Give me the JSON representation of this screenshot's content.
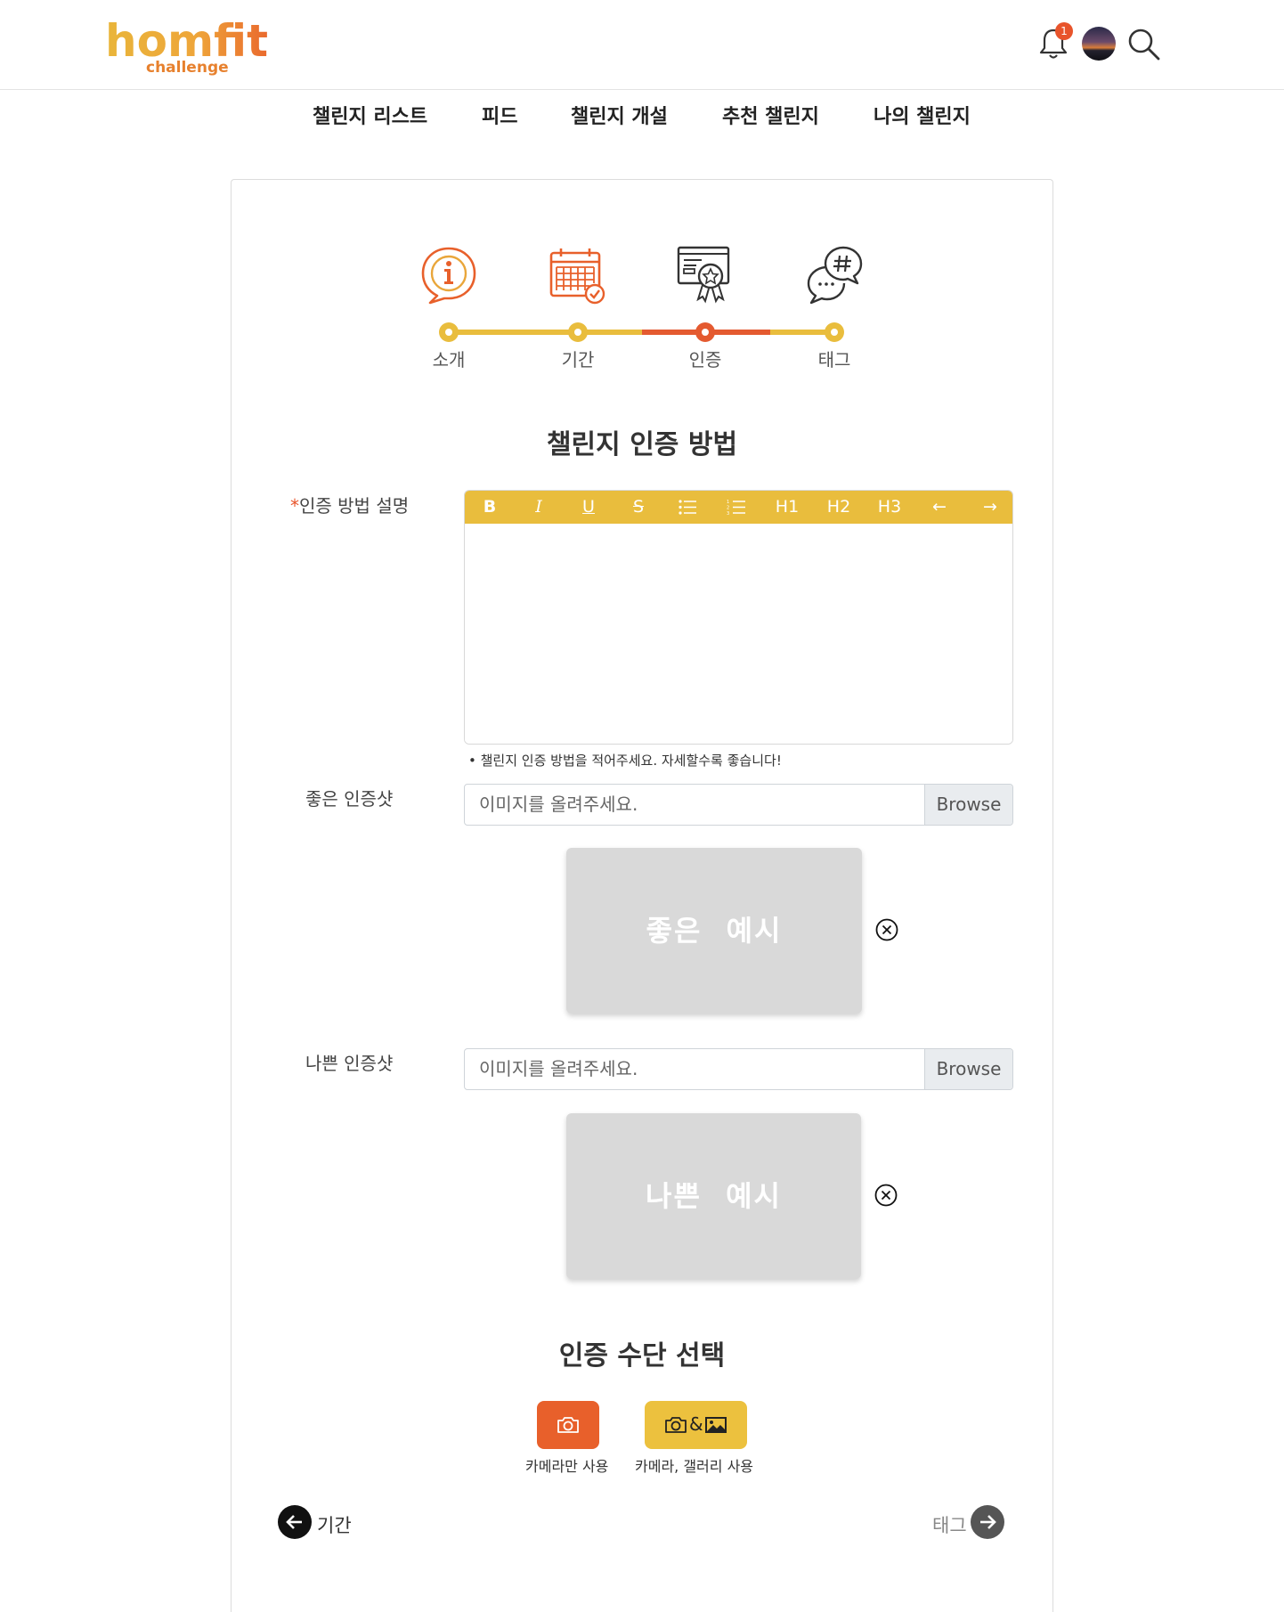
{
  "header": {
    "logo_main": "homfit",
    "logo_sub": "challenge",
    "notification_count": "1"
  },
  "nav": [
    "챌린지 리스트",
    "피드",
    "챌린지 개설",
    "추천 챌린지",
    "나의 챌린지"
  ],
  "steps": [
    {
      "label": "소개",
      "icon": "info-icon",
      "state": "done"
    },
    {
      "label": "기간",
      "icon": "calendar-icon",
      "state": "done"
    },
    {
      "label": "인증",
      "icon": "certificate-icon",
      "state": "current"
    },
    {
      "label": "태그",
      "icon": "hashtag-chat-icon",
      "state": "pending"
    }
  ],
  "section_title": "챌린지 인증 방법",
  "description_field": {
    "required_mark": "*",
    "label": "인증 방법 설명",
    "toolbar": [
      "B",
      "I",
      "U",
      "S",
      "bulleted-list",
      "numbered-list",
      "H1",
      "H2",
      "H3",
      "←",
      "→"
    ],
    "hint": "• 챌린지 인증 방법을 적어주세요. 자세할수록 좋습니다!"
  },
  "good_shot": {
    "label": "좋은 인증샷",
    "placeholder": "이미지를 올려주세요.",
    "browse": "Browse",
    "example": "좋은 예시"
  },
  "bad_shot": {
    "label": "나쁜 인증샷",
    "placeholder": "이미지를 올려주세요.",
    "browse": "Browse",
    "example": "나쁜 예시"
  },
  "method_section": {
    "title": "인증 수단 선택",
    "options": [
      {
        "label": "카메라만 사용",
        "icon": "camera-icon",
        "color": "#e8602b"
      },
      {
        "label": "카메라, 갤러리 사용",
        "icon": "camera-gallery-icon",
        "color": "#ecc13e",
        "separator": "&"
      }
    ]
  },
  "pager": {
    "prev": "기간",
    "next": "태그"
  },
  "colors": {
    "accent_yellow": "#e9bd3d",
    "accent_orange": "#e8542b",
    "text_dark": "#333333"
  }
}
